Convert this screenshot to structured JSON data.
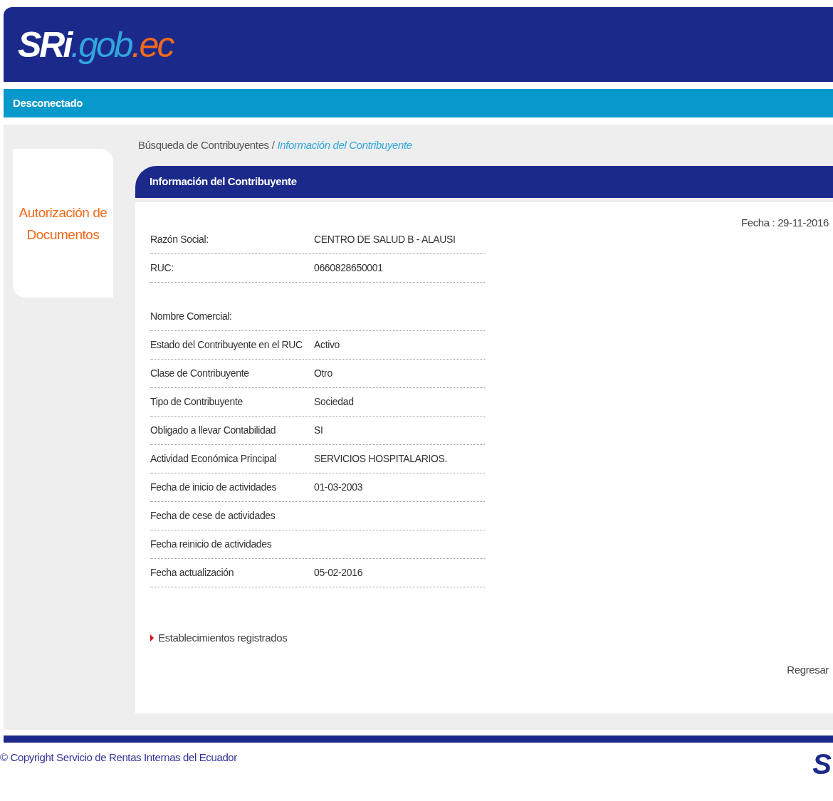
{
  "logo": {
    "brand": "SRi",
    "middle": ".gob",
    "suffix": ".ec"
  },
  "status_bar": "Desconectado",
  "sidebar": {
    "title": "Autorización de Documentos"
  },
  "breadcrumb": [
    {
      "label": "Búsqueda de Contribuyentes",
      "selected": false
    },
    {
      "label": "Información del Contribuyente",
      "selected": true
    }
  ],
  "breadcrumb_separator": "/",
  "panel": {
    "title": "Información del Contribuyente",
    "date": "Fecha : 29-11-2016",
    "sections": [
      [
        {
          "label": "Razón Social:",
          "value": "CENTRO DE SALUD B - ALAUSI"
        },
        {
          "label": "RUC:",
          "value": "0660828650001"
        }
      ],
      [
        {
          "label": "Nombre Comercial:"
        },
        {
          "label": "Estado del Contribuyente en el RUC",
          "value": "Activo"
        },
        {
          "label": "Clase de Contribuyente",
          "value": "Otro"
        },
        {
          "label": "Tipo de Contribuyente",
          "value": "Sociedad"
        },
        {
          "label": "Obligado a llevar Contabilidad",
          "value": "SI"
        },
        {
          "label": "Actividad Económica Principal",
          "value": "SERVICIOS HOSPITALARIOS."
        },
        {
          "label": "Fecha de inicio de actividades",
          "value": "01-03-2003"
        },
        {
          "label": "Fecha de cese de actividades"
        },
        {
          "label": "Fecha reinicio de actividades"
        },
        {
          "label": "Fecha actualización",
          "value": "05-02-2016"
        }
      ]
    ],
    "link": "Establecimientos registrados",
    "back": "Regresar"
  },
  "footer": {
    "copyright": "© Copyright Servicio de Rentas Internas del Ecuador",
    "logo": "S"
  }
}
